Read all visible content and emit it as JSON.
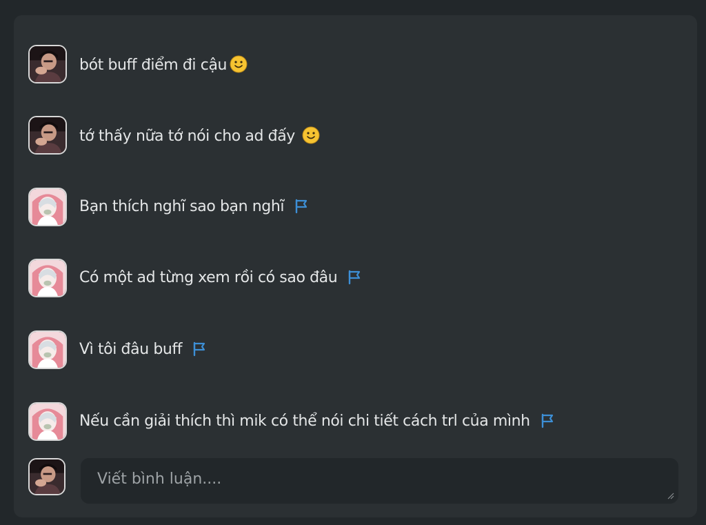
{
  "comments": [
    {
      "author_avatar": "user-avatar-photo",
      "text": "bót buff điểm đi cậu",
      "trailing_icon": "slightly-smiling-emoji",
      "flag_icon": null
    },
    {
      "author_avatar": "user-avatar-photo",
      "text": "tớ thấy nữa tớ nói cho ad đấy",
      "trailing_icon": "slightly-smiling-emoji",
      "flag_icon": null
    },
    {
      "author_avatar": "anime-avatar",
      "text": "Bạn thích nghĩ sao bạn nghĩ",
      "trailing_icon": null,
      "flag_icon": "report-flag-icon"
    },
    {
      "author_avatar": "anime-avatar",
      "text": "Có một ad từng xem rồi có sao đâu",
      "trailing_icon": null,
      "flag_icon": "report-flag-icon"
    },
    {
      "author_avatar": "anime-avatar",
      "text": "Vì tôi đâu buff",
      "trailing_icon": null,
      "flag_icon": "report-flag-icon"
    },
    {
      "author_avatar": "anime-avatar",
      "text": "Nếu cần giải thích thì mik có thể nói chi tiết cách trl của mình",
      "trailing_icon": null,
      "flag_icon": "report-flag-icon"
    }
  ],
  "composer": {
    "avatar": "user-avatar-photo",
    "value": "",
    "placeholder": "Viết bình luận...."
  },
  "colors": {
    "page_background": "#22272a",
    "panel_background": "#2b3033",
    "text": "#e4e6e7",
    "flag": "#3d8fd6",
    "emoji": "#f6c331"
  }
}
